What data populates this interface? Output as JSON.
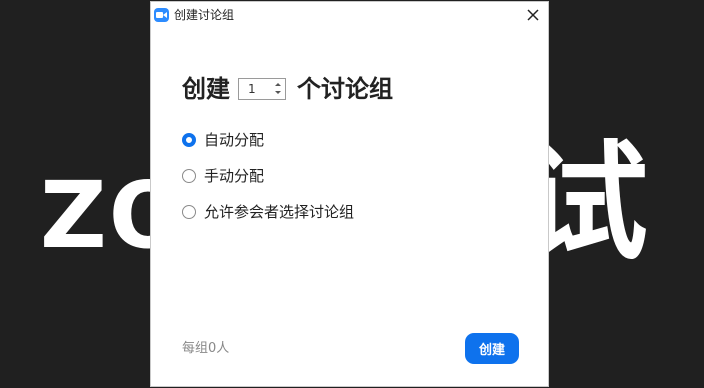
{
  "background": {
    "left_text": "ZO",
    "right_text": "试"
  },
  "window": {
    "title": "创建讨论组",
    "app_icon": "zoom-camera-icon",
    "close_icon": "close-icon"
  },
  "form": {
    "heading_prefix": "创建",
    "room_count": "1",
    "heading_suffix": "个讨论组",
    "options": [
      {
        "label": "自动分配",
        "selected": true
      },
      {
        "label": "手动分配",
        "selected": false
      },
      {
        "label": "允许参会者选择讨论组",
        "selected": false
      }
    ]
  },
  "footer": {
    "per_group_text": "每组0人",
    "create_label": "创建"
  },
  "colors": {
    "accent": "#0e72ed",
    "background": "#202020"
  }
}
